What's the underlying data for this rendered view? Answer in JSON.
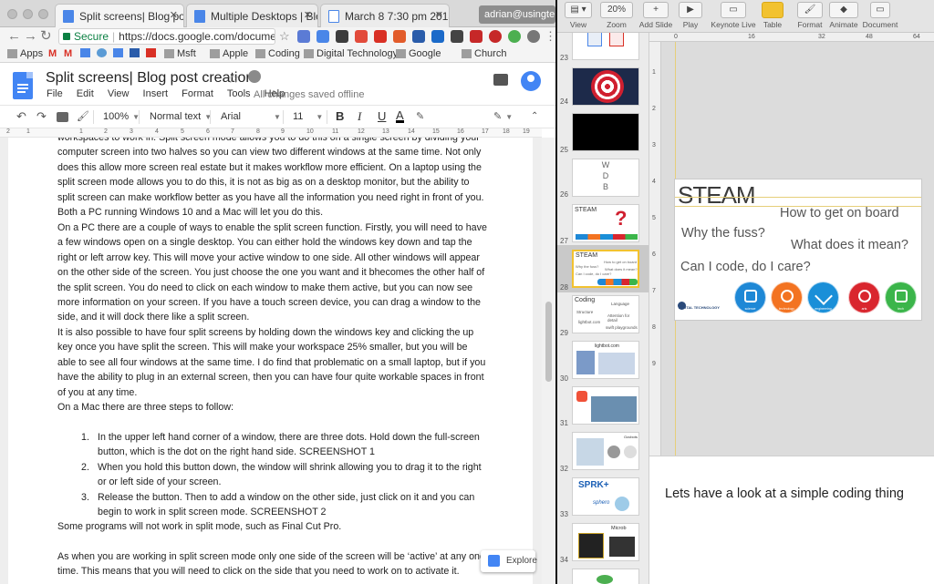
{
  "browser": {
    "tabs": [
      {
        "title": "Split screens| Blog post cre",
        "active": true
      },
      {
        "title": "Multiple Desktops | Blog p",
        "active": false
      },
      {
        "title": "March 8 7:30 pm 2018 - att",
        "active": false
      }
    ],
    "profile_name": "adrian@usingte...",
    "secure_label": "Secure",
    "url": "https://docs.google.com/document/...",
    "bookmarks": [
      "Apps",
      "Msft",
      "Apple",
      "Coding",
      "Digital Technology",
      "Google",
      "Church"
    ]
  },
  "doc": {
    "title": "Split screens| Blog post creation",
    "menu": [
      "File",
      "Edit",
      "View",
      "Insert",
      "Format",
      "Tools",
      "Help"
    ],
    "save_status": "All changes saved offline",
    "toolbar": {
      "zoom": "100%",
      "style": "Normal text",
      "font": "Arial",
      "size": "11",
      "bold": "B",
      "italic": "I",
      "underline": "U",
      "text_color": "A"
    },
    "ruler_numbers": [
      "2",
      "1",
      "1",
      "2",
      "3",
      "4",
      "5",
      "6",
      "7",
      "8",
      "9",
      "10",
      "11",
      "12",
      "13",
      "14",
      "15",
      "16",
      "17",
      "18",
      "19"
    ],
    "paragraphs": [
      "workspaces to work in. Split screen mode allows you to do this on a single screen by dividing your computer screen into two halves so you can view two different windows at the same time. Not only does this allow more screen real estate but it makes workflow more efficient. On a laptop using the split screen mode allows you to do this, it is not as big as on a desktop monitor, but the ability to split screen can make workflow better as you have all the information you need right in front of you. Both a PC running Windows 10 and a Mac will let you do this.",
      "On a PC there are a couple of ways to enable the split screen function. Firstly, you will need to have a few windows open on a single desktop. You can either hold the windows key down and tap the right or left arrow key. This will move your active window to one side. All other windows will appear on the other side of the screen. You just choose the one you want and it bhecomes the other half of the split screen. You do need to click on each window to make them active, but you can now see more information on your screen. If you have a touch screen device, you can drag a window to the side, and it will dock there like a split screen.",
      "It is also possible to have four split screens by holding down the windows key and clicking the up key once you have split the screen. This will make your workspace 25% smaller, but you will be able to see all four windows at the same time. I do find that problematic on a small laptop, but if you have the ability to plug in an external screen, then you can have four quite workable spaces in front of you at any time.",
      "On a Mac there are three steps to follow:"
    ],
    "steps": [
      "In the upper left hand corner of a window, there are three dots. Hold down the full-screen button, which is the dot on the right hand side. SCREENSHOT 1",
      "When you hold this button down, the window will shrink allowing you to drag it to the right or or left side of your screen.",
      "Release the button. Then to add a window on the other side, just click on it and you can begin to work in split screen mode. SCREENSHOT 2"
    ],
    "after_list": [
      "Some programs will not work in split mode, such as Final Cut Pro.",
      "As when you are working in split screen mode only one side of the screen will be ‘active’ at any one time. This means that you will need to click on the side that you need to work on to activate it."
    ],
    "explore_label": "Explore"
  },
  "keynote": {
    "toolbar": [
      {
        "label": "View",
        "icon": "view-icon"
      },
      {
        "label": "Zoom",
        "value": "20%",
        "icon": "zoom-icon"
      },
      {
        "label": "Add Slide",
        "icon": "add-slide-icon"
      },
      {
        "label": "Play",
        "icon": "play-icon"
      },
      {
        "label": "Keynote Live",
        "icon": "keynote-live-icon"
      },
      {
        "label": "Table",
        "icon": "table-icon"
      },
      {
        "label": "Format",
        "icon": "format-icon"
      },
      {
        "label": "Animate",
        "icon": "animate-icon"
      },
      {
        "label": "Document",
        "icon": "document-icon"
      }
    ],
    "h_ruler": [
      "0",
      "16",
      "32",
      "48",
      "64"
    ],
    "v_ruler": [
      "1",
      "2",
      "3",
      "4",
      "5",
      "6",
      "7",
      "8",
      "9"
    ],
    "slide_numbers": [
      "23",
      "24",
      "25",
      "26",
      "27",
      "28",
      "29",
      "30",
      "31",
      "32",
      "33",
      "34"
    ],
    "selected_slide": "28",
    "thumb_texts": {
      "s26": [
        "W",
        "D",
        "B"
      ],
      "s27": "STEAM",
      "s28": [
        "STEAM",
        "How to get on board",
        "Why the fuss?",
        "What does it mean?",
        "Can I code, do I care?"
      ],
      "s29": [
        "Coding",
        "Language",
        "Structure",
        "Attention for detail",
        "lightbot.com",
        "swift playgrounds"
      ],
      "s30": "lightbot.com",
      "s32": "Ozobots",
      "s33": [
        "SPRK+",
        "sphero"
      ],
      "s34": "Microb"
    },
    "slide": {
      "title": "STEAM",
      "line1": "How to get on board",
      "line2": "Why the fuss?",
      "line3": "What does it mean?",
      "line4": "Can I code, do I care?",
      "logo_text": "DIGITAL TECHNOLOGY",
      "circles": [
        {
          "label": "science",
          "color": "#1e88d6"
        },
        {
          "label": "technology",
          "color": "#f37321"
        },
        {
          "label": "engineering",
          "color": "#1a8fd8"
        },
        {
          "label": "arts",
          "color": "#d9262e"
        },
        {
          "label": "tech",
          "color": "#3bb54a"
        }
      ]
    },
    "notes": "Lets have a look at a simple coding thing"
  }
}
